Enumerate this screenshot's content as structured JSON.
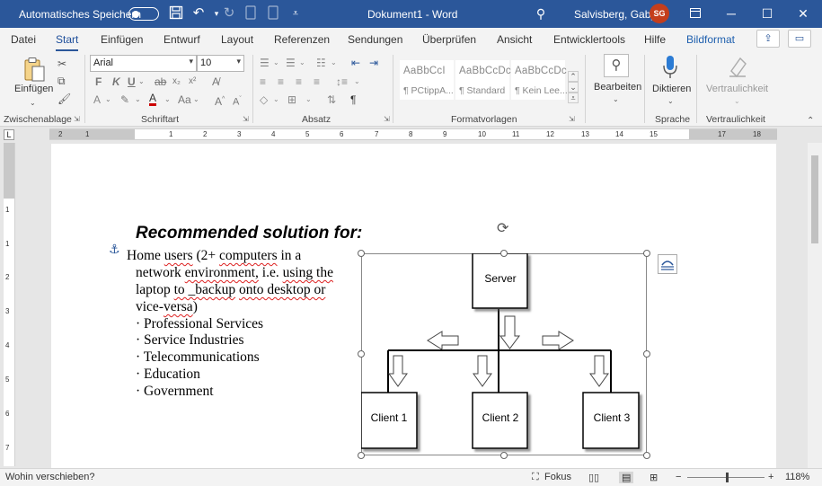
{
  "titlebar": {
    "autosave_label": "Automatisches Speichern",
    "doc_title": "Dokument1 - Word",
    "user_name": "Salvisberg, Gaby",
    "user_initials": "SG"
  },
  "tabs": [
    "Datei",
    "Start",
    "Einfügen",
    "Entwurf",
    "Layout",
    "Referenzen",
    "Sendungen",
    "Überprüfen",
    "Ansicht",
    "Entwicklertools",
    "Hilfe",
    "Bildformat"
  ],
  "active_tab": "Start",
  "ribbon": {
    "clipboard": {
      "paste_label": "Einfügen",
      "group_label": "Zwischenablage"
    },
    "font": {
      "font_name": "Arial",
      "font_size": "10",
      "group_label": "Schriftart"
    },
    "paragraph": {
      "group_label": "Absatz"
    },
    "styles": {
      "group_label": "Formatvorlagen",
      "items": [
        {
          "preview": "AaBbCcI",
          "name": "¶ PCtippA..."
        },
        {
          "preview": "AaBbCcDc",
          "name": "¶ Standard"
        },
        {
          "preview": "AaBbCcDc",
          "name": "¶ Kein Lee..."
        }
      ]
    },
    "editing": {
      "label": "Bearbeiten"
    },
    "voice": {
      "label": "Diktieren",
      "group_label": "Sprache"
    },
    "sensitivity": {
      "label": "Vertraulichkeit",
      "group_label": "Vertraulichkeit"
    }
  },
  "ruler": {
    "numbers": [
      "2",
      "1",
      "1",
      "2",
      "3",
      "4",
      "5",
      "6",
      "7",
      "8",
      "9",
      "10",
      "11",
      "12",
      "13",
      "14",
      "15",
      "17",
      "18"
    ],
    "vnumbers": [
      "1",
      "1",
      "2",
      "3",
      "4",
      "5",
      "6",
      "7"
    ]
  },
  "document": {
    "heading": "Recommended solution for:",
    "lines": {
      "l1a": "Home ",
      "l1b": "users",
      "l1c": " (2+ ",
      "l1d": "computers",
      "l1e": " in a",
      "l2a": "network ",
      "l2b": "environment,",
      "l2c": " i.e. ",
      "l2d": "using the",
      "l3a": "laptop ",
      "l3b": "to _backup",
      "l3c": " ",
      "l3d": "onto desktop or",
      "l4a": "vice-",
      "l4b": "versa",
      "l4c": ")"
    },
    "bullets": [
      "· Professional Services",
      "· Service Industries",
      "· Telecommunications",
      "· Education",
      "· Government"
    ]
  },
  "diagram": {
    "server": "Server",
    "clients": [
      "Client 1",
      "Client 2",
      "Client 3"
    ]
  },
  "status": {
    "hint": "Wohin verschieben?",
    "focus": "Fokus",
    "zoom": "118%"
  }
}
